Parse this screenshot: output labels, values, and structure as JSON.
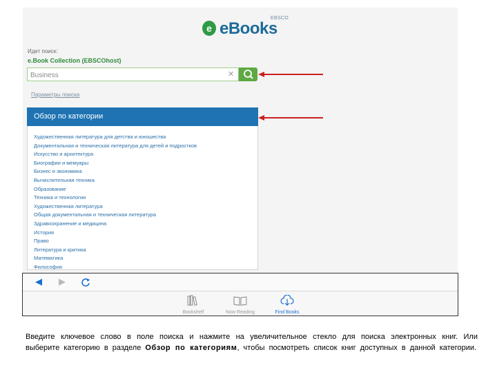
{
  "logo": {
    "brand": "EBSCO",
    "product": "eBooks",
    "badge": "e"
  },
  "search": {
    "label": "Идет поиск:",
    "collection": "e.Book Collection (EBSCOhost)",
    "value": "Business",
    "params_link": "Параметры поиска"
  },
  "browse": {
    "title": "Обзор по категории",
    "categories": [
      "Художественная литература для детства и юношества",
      "Документальная и техническая литература для детей и подростков",
      "Искусство и архитектура",
      "Биографии и мемуары",
      "Бизнес и экономика",
      "Вычислительная техника",
      "Образование",
      "Техника и технологии",
      "Художественная литература",
      "Общая документальная и техническая литература",
      "Здравоохранение и медицина",
      "История",
      "Право",
      "Литература и критика",
      "Математика",
      "Философия"
    ]
  },
  "toolbar": {
    "tabs": [
      {
        "label": "Bookshelf",
        "icon": "bookshelf-icon"
      },
      {
        "label": "Now Reading",
        "icon": "open-book-icon"
      },
      {
        "label": "Find Books",
        "icon": "download-cloud-icon"
      }
    ]
  },
  "caption": {
    "part1": "Введите ключевое слово в поле поиска и нажмите на увеличительное стекло для поиска электронных книг. Или выберите категорию в разделе ",
    "bold": "Обзор по категориям",
    "part2": ", чтобы посмотреть список книг доступных в данной категории."
  },
  "colors": {
    "accent_blue": "#1f73b2",
    "green": "#5ea943",
    "arrow_red": "#cc1f1f",
    "link_blue": "#2a6fa8"
  }
}
